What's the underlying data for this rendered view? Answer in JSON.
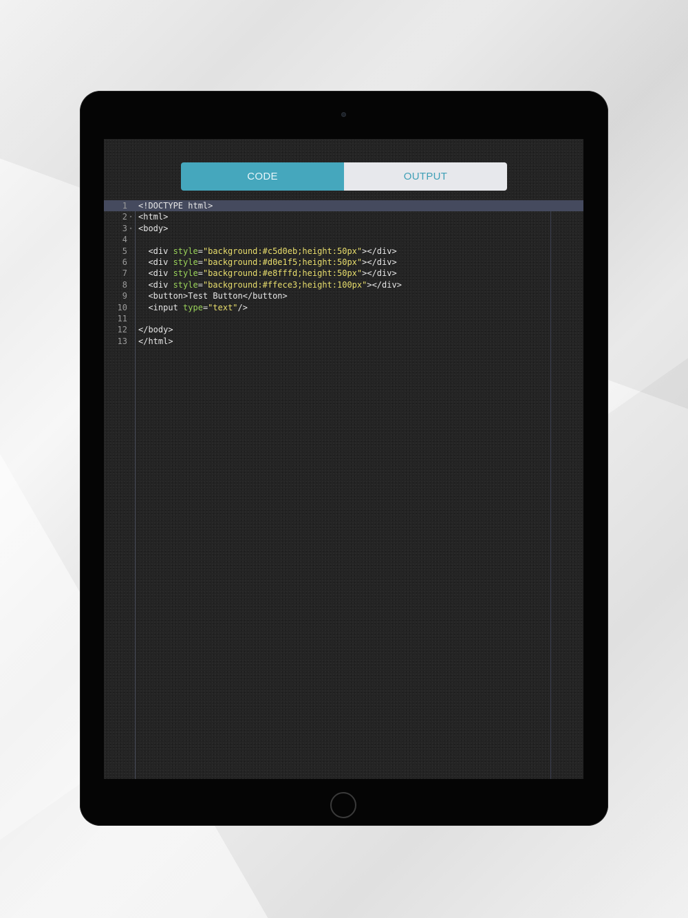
{
  "tabs": {
    "code_label": "CODE",
    "output_label": "OUTPUT",
    "active": "code"
  },
  "colors": {
    "accent": "#45a7bd",
    "editor_bg": "#242424",
    "attr": "#9bd35a",
    "string": "#e8dd6c",
    "current_line": "#454a5e"
  },
  "editor": {
    "current_line": 1,
    "lines": [
      {
        "num": "1",
        "fold": false,
        "tokens": [
          {
            "t": "tag",
            "v": "<!DOCTYPE html>"
          }
        ]
      },
      {
        "num": "2",
        "fold": true,
        "tokens": [
          {
            "t": "tag",
            "v": "<html>"
          }
        ]
      },
      {
        "num": "3",
        "fold": true,
        "tokens": [
          {
            "t": "tag",
            "v": "<body>"
          }
        ]
      },
      {
        "num": "4",
        "fold": false,
        "tokens": []
      },
      {
        "num": "5",
        "fold": false,
        "tokens": [
          {
            "t": "tag",
            "v": "  <div "
          },
          {
            "t": "attr",
            "v": "style"
          },
          {
            "t": "eq",
            "v": "="
          },
          {
            "t": "str",
            "v": "\"background:#c5d0eb;height:50px\""
          },
          {
            "t": "tag",
            "v": "></div>"
          }
        ]
      },
      {
        "num": "6",
        "fold": false,
        "tokens": [
          {
            "t": "tag",
            "v": "  <div "
          },
          {
            "t": "attr",
            "v": "style"
          },
          {
            "t": "eq",
            "v": "="
          },
          {
            "t": "str",
            "v": "\"background:#d0e1f5;height:50px\""
          },
          {
            "t": "tag",
            "v": "></div>"
          }
        ]
      },
      {
        "num": "7",
        "fold": false,
        "tokens": [
          {
            "t": "tag",
            "v": "  <div "
          },
          {
            "t": "attr",
            "v": "style"
          },
          {
            "t": "eq",
            "v": "="
          },
          {
            "t": "str",
            "v": "\"background:#e8fffd;height:50px\""
          },
          {
            "t": "tag",
            "v": "></div>"
          }
        ]
      },
      {
        "num": "8",
        "fold": false,
        "tokens": [
          {
            "t": "tag",
            "v": "  <div "
          },
          {
            "t": "attr",
            "v": "style"
          },
          {
            "t": "eq",
            "v": "="
          },
          {
            "t": "str",
            "v": "\"background:#ffece3;height:100px\""
          },
          {
            "t": "tag",
            "v": "></div>"
          }
        ]
      },
      {
        "num": "9",
        "fold": false,
        "tokens": [
          {
            "t": "tag",
            "v": "  <button>Test Button</button>"
          }
        ]
      },
      {
        "num": "10",
        "fold": false,
        "tokens": [
          {
            "t": "tag",
            "v": "  <input "
          },
          {
            "t": "attr",
            "v": "type"
          },
          {
            "t": "eq",
            "v": "="
          },
          {
            "t": "str",
            "v": "\"text\""
          },
          {
            "t": "tag",
            "v": "/>"
          }
        ]
      },
      {
        "num": "11",
        "fold": false,
        "tokens": []
      },
      {
        "num": "12",
        "fold": false,
        "tokens": [
          {
            "t": "tag",
            "v": "</body>"
          }
        ]
      },
      {
        "num": "13",
        "fold": false,
        "tokens": [
          {
            "t": "tag",
            "v": "</html>"
          }
        ]
      }
    ]
  }
}
